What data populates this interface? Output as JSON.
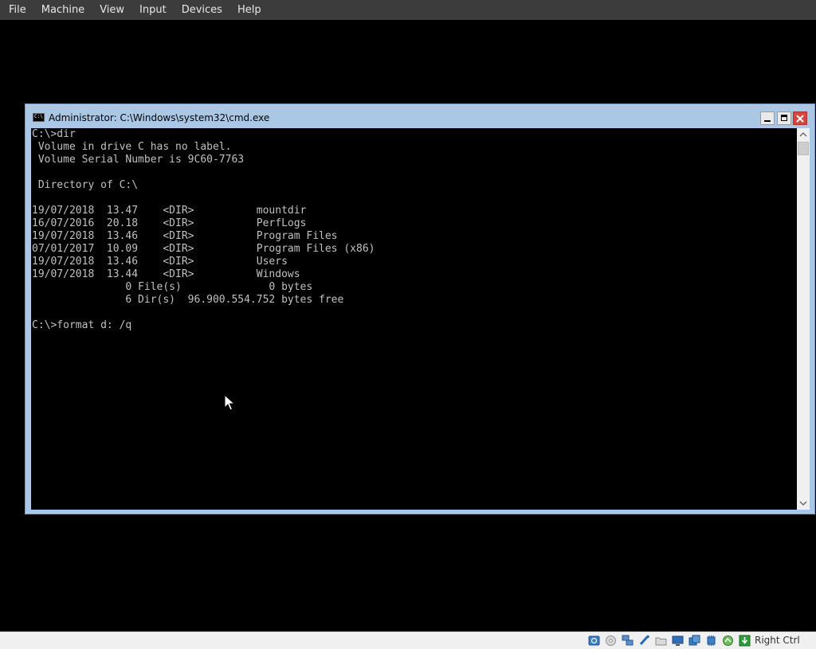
{
  "menubar": {
    "items": [
      "File",
      "Machine",
      "View",
      "Input",
      "Devices",
      "Help"
    ]
  },
  "cmd_window": {
    "title": "Administrator: C:\\Windows\\system32\\cmd.exe"
  },
  "console": {
    "lines": [
      "C:\\>dir",
      " Volume in drive C has no label.",
      " Volume Serial Number is 9C60-7763",
      "",
      " Directory of C:\\",
      "",
      "19/07/2018  13.47    <DIR>          mountdir",
      "16/07/2016  20.18    <DIR>          PerfLogs",
      "19/07/2018  13.46    <DIR>          Program Files",
      "07/01/2017  10.09    <DIR>          Program Files (x86)",
      "19/07/2018  13.46    <DIR>          Users",
      "19/07/2018  13.44    <DIR>          Windows",
      "               0 File(s)              0 bytes",
      "               6 Dir(s)  96.900.554.752 bytes free",
      "",
      "C:\\>format d: /q"
    ]
  },
  "statusbar": {
    "icons": [
      "hard-disk-icon",
      "optical-drive-icon",
      "network-icon",
      "usb-icon",
      "shared-folder-icon",
      "display-icon",
      "video-capture-icon",
      "cpu-icon",
      "mouse-integration-icon",
      "keyboard-capture-icon"
    ],
    "host_key": "Right Ctrl"
  },
  "colors": {
    "menubar_bg": "#3c3c3c",
    "title_bar": "#aac8e6",
    "close_button": "#d8453f",
    "console_bg": "#000000",
    "console_text": "#c0c0c0",
    "statusbar_bg": "#f0f0f0"
  }
}
